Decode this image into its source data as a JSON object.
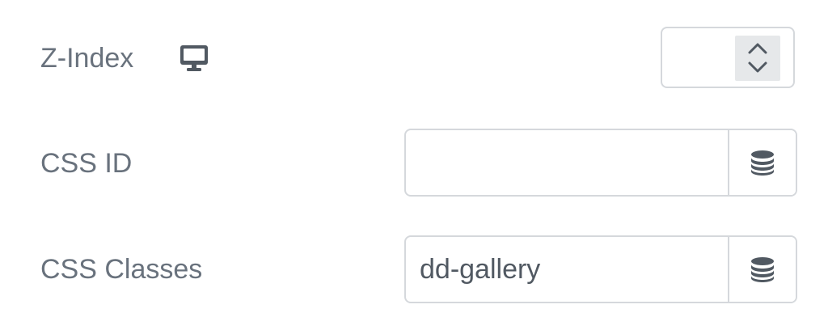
{
  "zindex": {
    "label": "Z-Index",
    "device_icon": "desktop-monitor-icon",
    "value": ""
  },
  "css_id": {
    "label": "CSS ID",
    "value": "",
    "dynamic_icon": "database-icon"
  },
  "css_classes": {
    "label": "CSS Classes",
    "value": "dd-gallery",
    "dynamic_icon": "database-icon"
  },
  "colors": {
    "label": "#69727d",
    "border": "#d5d8dc",
    "icon": "#515962",
    "spinner_bg": "#e6e8ea"
  }
}
